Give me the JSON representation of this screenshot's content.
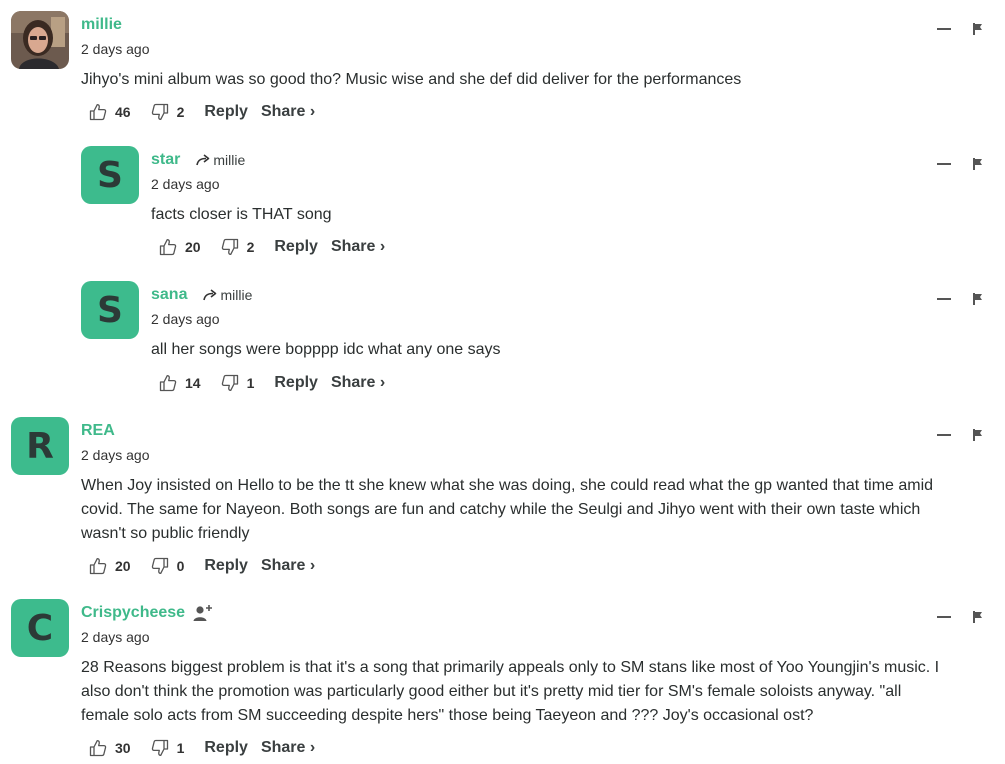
{
  "colors": {
    "accent": "#3fb98a",
    "avatar_bg": "#3dbb8d"
  },
  "icons": {
    "upvote": "thumbs-up-icon",
    "downvote": "thumbs-down-icon",
    "collapse": "minus-icon",
    "flag": "flag-icon",
    "reply_arrow": "reply-arrow-icon",
    "follow": "add-user-icon"
  },
  "actions": {
    "reply_label": "Reply",
    "share_label": "Share ›"
  },
  "comments": [
    {
      "author": "millie",
      "time": "2 days ago",
      "text": "Jihyo's mini album was so good tho? Music wise and she def did deliver for the performances",
      "upvotes": "46",
      "downvotes": "2"
    },
    {
      "author": "star",
      "avatar_letter": "S",
      "reply_to": "millie",
      "time": "2 days ago",
      "text": "facts closer is THAT song",
      "upvotes": "20",
      "downvotes": "2"
    },
    {
      "author": "sana",
      "avatar_letter": "S",
      "reply_to": "millie",
      "time": "2 days ago",
      "text": "all her songs were bopppp idc what any one says",
      "upvotes": "14",
      "downvotes": "1"
    },
    {
      "author": "REA",
      "avatar_letter": "R",
      "time": "2 days ago",
      "text_lines": [
        "When Joy insisted on Hello to be the tt she knew what she was doing, she could read what the gp wanted that time amid",
        "covid. The same for Nayeon. Both songs are fun and catchy while the Seulgi and Jihyo went with their own taste which",
        "wasn't so public friendly"
      ],
      "upvotes": "20",
      "downvotes": "0"
    },
    {
      "author": "Crispycheese",
      "avatar_letter": "C",
      "time": "2 days ago",
      "text_lines": [
        "28 Reasons biggest problem is that it's a song that primarily appeals only to SM stans like most of Yoo Youngjin's music. I",
        "also don't think the promotion was particularly good either but it's pretty mid tier for SM's female soloists anyway. \"all",
        "female solo acts from SM succeeding despite hers\" those being Taeyeon and ??? Joy's occasional ost?"
      ],
      "upvotes": "30",
      "downvotes": "1"
    }
  ]
}
